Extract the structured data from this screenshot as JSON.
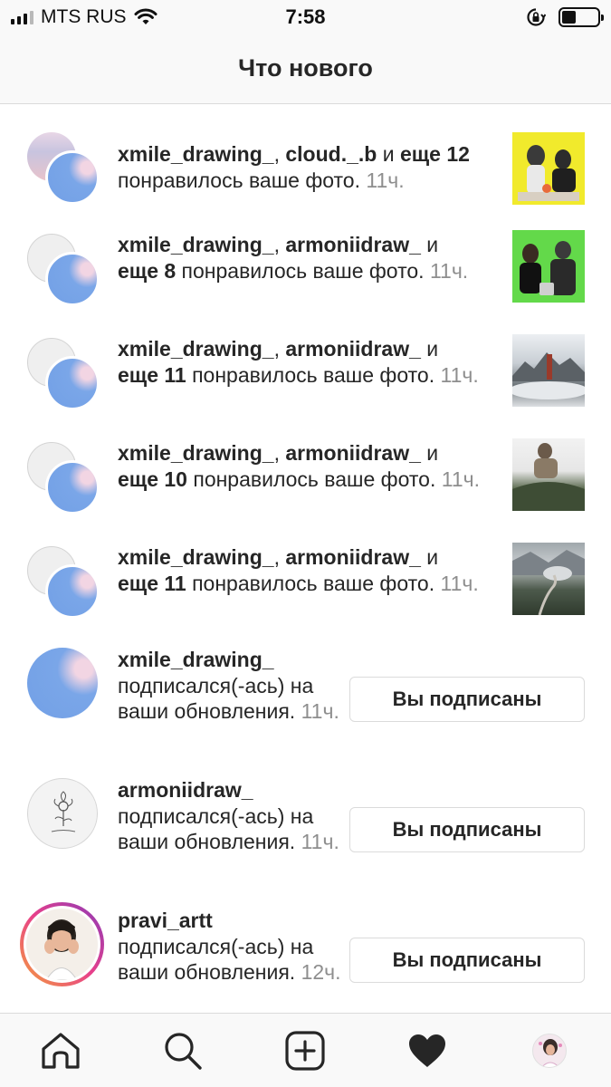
{
  "status_bar": {
    "carrier": "MTS RUS",
    "time": "7:58",
    "battery_level": 0.4
  },
  "header": {
    "title": "Что нового"
  },
  "activity": [
    {
      "type": "like",
      "user1": "xmile_drawing_",
      "sep": ", ",
      "user2": "cloud._.b",
      "and": " и ",
      "more": "еще 12",
      "action": " понравилось ваше фото. ",
      "time": "11ч."
    },
    {
      "type": "like",
      "user1": "xmile_drawing_",
      "sep": ", ",
      "user2": "armoniidraw_",
      "and": " и ",
      "more": "еще 8",
      "action": " понравилось ваше фото. ",
      "time": "11ч."
    },
    {
      "type": "like",
      "user1": "xmile_drawing_",
      "sep": ", ",
      "user2": "armoniidraw_",
      "and": " и ",
      "more": "еще 11",
      "action": " понравилось ваше фото. ",
      "time": "11ч."
    },
    {
      "type": "like",
      "user1": "xmile_drawing_",
      "sep": ", ",
      "user2": "armoniidraw_",
      "and": " и ",
      "more": "еще 10",
      "action": " понравилось ваше фото. ",
      "time": "11ч."
    },
    {
      "type": "like",
      "user1": "xmile_drawing_",
      "sep": ", ",
      "user2": "armoniidraw_",
      "and": " и ",
      "more": "еще 11",
      "action": " понравилось ваше фото. ",
      "time": "11ч."
    },
    {
      "type": "follow",
      "user": "xmile_drawing_",
      "action": "подписался(-ась) на ваши обновления. ",
      "time": "11ч.",
      "button": "Вы подписаны"
    },
    {
      "type": "follow",
      "user": "armoniidraw_",
      "action": "подписался(-ась) на ваши обновления. ",
      "time": "11ч.",
      "button": "Вы подписаны"
    },
    {
      "type": "follow",
      "user": "pravi_artt",
      "action": "подписался(-ась) на ваши обновления. ",
      "time": "12ч.",
      "button": "Вы подписаны"
    }
  ],
  "tabs": [
    {
      "icon": "home-icon"
    },
    {
      "icon": "search-icon"
    },
    {
      "icon": "add-post-icon"
    },
    {
      "icon": "heart-filled-icon"
    },
    {
      "icon": "profile-avatar"
    }
  ],
  "colors": {
    "text": "#262626",
    "muted": "#8e8e8e",
    "border": "#dbdbdb",
    "bar_bg": "#f9f9f9",
    "story_ring_start": "#f4a03b",
    "story_ring_end": "#8a3ab9"
  }
}
